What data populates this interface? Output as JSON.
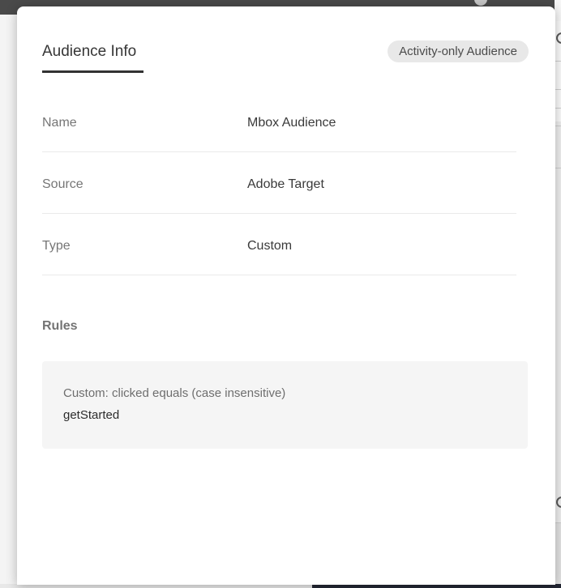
{
  "modal": {
    "tab_label": "Audience Info",
    "badge_label": "Activity-only Audience",
    "fields": [
      {
        "label": "Name",
        "value": "Mbox Audience"
      },
      {
        "label": "Source",
        "value": "Adobe Target"
      },
      {
        "label": "Type",
        "value": "Custom"
      }
    ],
    "rules": {
      "heading": "Rules",
      "items": [
        {
          "condition": "Custom: clicked equals (case insensitive)",
          "value": "getStarted"
        }
      ]
    }
  },
  "colors": {
    "top_bar": "#4a4a4a",
    "page_background": "#f4f4f4",
    "modal_background": "#ffffff",
    "tab_underline": "#323232",
    "badge_background": "#e8e8e8",
    "badge_text": "#4b4b4b",
    "field_label_text": "#767676",
    "field_value_text": "#3a3a3a",
    "rules_box_background": "#f5f5f5",
    "bottom_bar_dark": "#232734"
  }
}
